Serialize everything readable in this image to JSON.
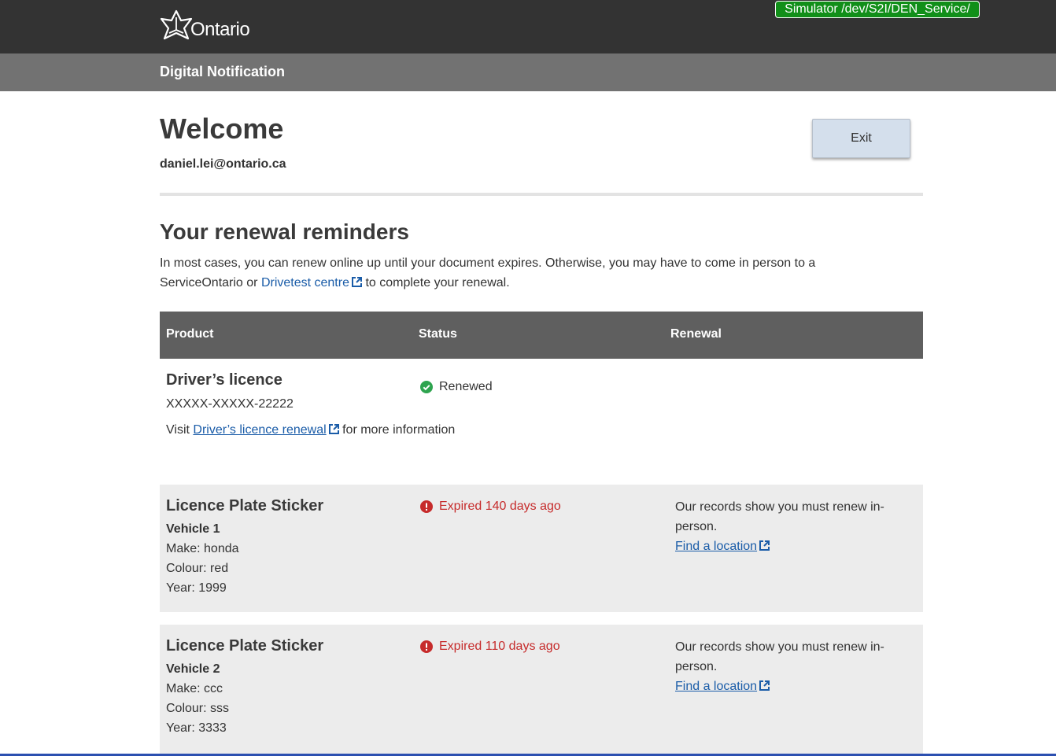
{
  "header": {
    "logo_text": "Ontario",
    "simulator_badge": "Simulator /dev/S2I/DEN_Service/",
    "app_title": "Digital Notification"
  },
  "welcome": {
    "title": "Welcome",
    "email": "daniel.lei@ontario.ca",
    "exit_label": "Exit"
  },
  "reminders": {
    "title": "Your renewal reminders",
    "intro_before": "In most cases, you can renew online up until your document expires. Otherwise, you may have to come in person to a ServiceOntario or ",
    "intro_link": "Drivetest centre",
    "intro_after": "to complete your renewal.",
    "columns": [
      "Product",
      "Status",
      "Renewal"
    ]
  },
  "rows": [
    {
      "product": "Driver’s licence",
      "number": "XXXXX-XXXXX-22222",
      "visit_prefix": "Visit",
      "visit_link": "Driver’s licence renewal",
      "visit_suffix": "for more information",
      "status": "Renewed",
      "status_type": "ok"
    },
    {
      "product": "Licence Plate Sticker",
      "vehicle": "Vehicle 1",
      "make": "Make: honda",
      "colour": "Colour: red",
      "year": "Year: 1999",
      "status": "Expired 140 days ago",
      "status_type": "error",
      "renewal_text": "Our records show you must renew in-person.",
      "renewal_link": "Find a location"
    },
    {
      "product": "Licence Plate Sticker",
      "vehicle": "Vehicle 2",
      "make": "Make: ccc",
      "colour": "Colour: sss",
      "year": "Year: 3333",
      "status": "Expired 110 days ago",
      "status_type": "error",
      "renewal_text": "Our records show you must renew in-person.",
      "renewal_link": "Find a location"
    }
  ],
  "colors": {
    "topbar": "#333333",
    "subbar": "#727272",
    "badge": "#118f19",
    "link": "#1a5ca8",
    "error": "#c62b2b",
    "success": "#2ea44f"
  }
}
